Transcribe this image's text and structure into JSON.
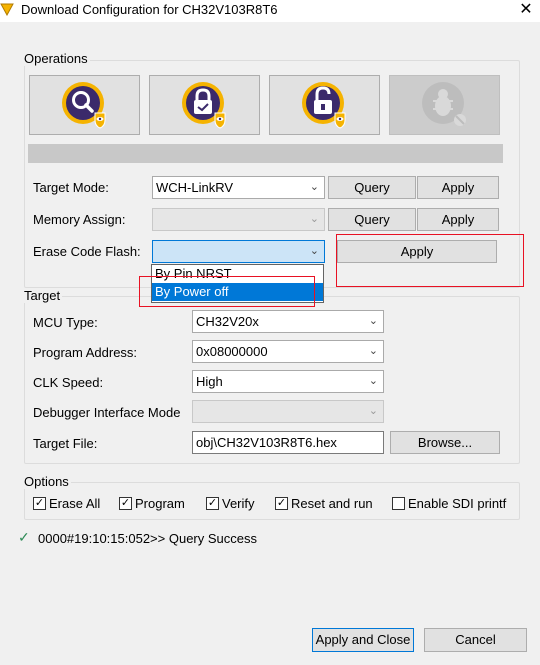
{
  "window": {
    "title": "Download Configuration for CH32V103R8T6",
    "close_glyph": "✕"
  },
  "operations": {
    "label": "Operations",
    "buttons": [
      {
        "name": "query-chip-button",
        "icon": "magnifier-shield-icon"
      },
      {
        "name": "lock-chip-button",
        "icon": "lock-shield-icon"
      },
      {
        "name": "unlock-chip-button",
        "icon": "unlock-shield-icon"
      },
      {
        "name": "disabled-bug-button",
        "icon": "bug-icon"
      }
    ],
    "progress": 0
  },
  "target_mode": {
    "label": "Target Mode:",
    "value": "WCH-LinkRV",
    "query": "Query",
    "apply": "Apply"
  },
  "memory_assign": {
    "label": "Memory Assign:",
    "value": "",
    "query": "Query",
    "apply": "Apply"
  },
  "erase_code_flash": {
    "label": "Erase Code Flash:",
    "value": "",
    "apply": "Apply",
    "options": [
      "By Pin NRST",
      "By Power off"
    ],
    "selected_index": 1
  },
  "target": {
    "label": "Target",
    "mcu_type": {
      "label": "MCU Type:",
      "value": "CH32V20x"
    },
    "program_address": {
      "label": "Program Address:",
      "value": "0x08000000"
    },
    "clk_speed": {
      "label": "CLK Speed:",
      "value": "High"
    },
    "debugger_interface": {
      "label": "Debugger Interface Mode",
      "value": ""
    },
    "target_file": {
      "label": "Target File:",
      "value": "obj\\CH32V103R8T6.hex",
      "browse": "Browse..."
    }
  },
  "options": {
    "label": "Options",
    "items": [
      {
        "label": "Erase All",
        "checked": true
      },
      {
        "label": "Program",
        "checked": true
      },
      {
        "label": "Verify",
        "checked": true
      },
      {
        "label": "Reset and run",
        "checked": true
      },
      {
        "label": "Enable SDI printf",
        "checked": false
      }
    ]
  },
  "status": {
    "icon": "check-icon",
    "text": "0000#19:10:15:052>> Query Success"
  },
  "footer": {
    "apply_close": "Apply and Close",
    "cancel": "Cancel"
  },
  "colors": {
    "accent": "#0078d7",
    "highlight": "#e81123",
    "icon_purple": "#3b2a6b",
    "icon_gold": "#f5b301"
  }
}
